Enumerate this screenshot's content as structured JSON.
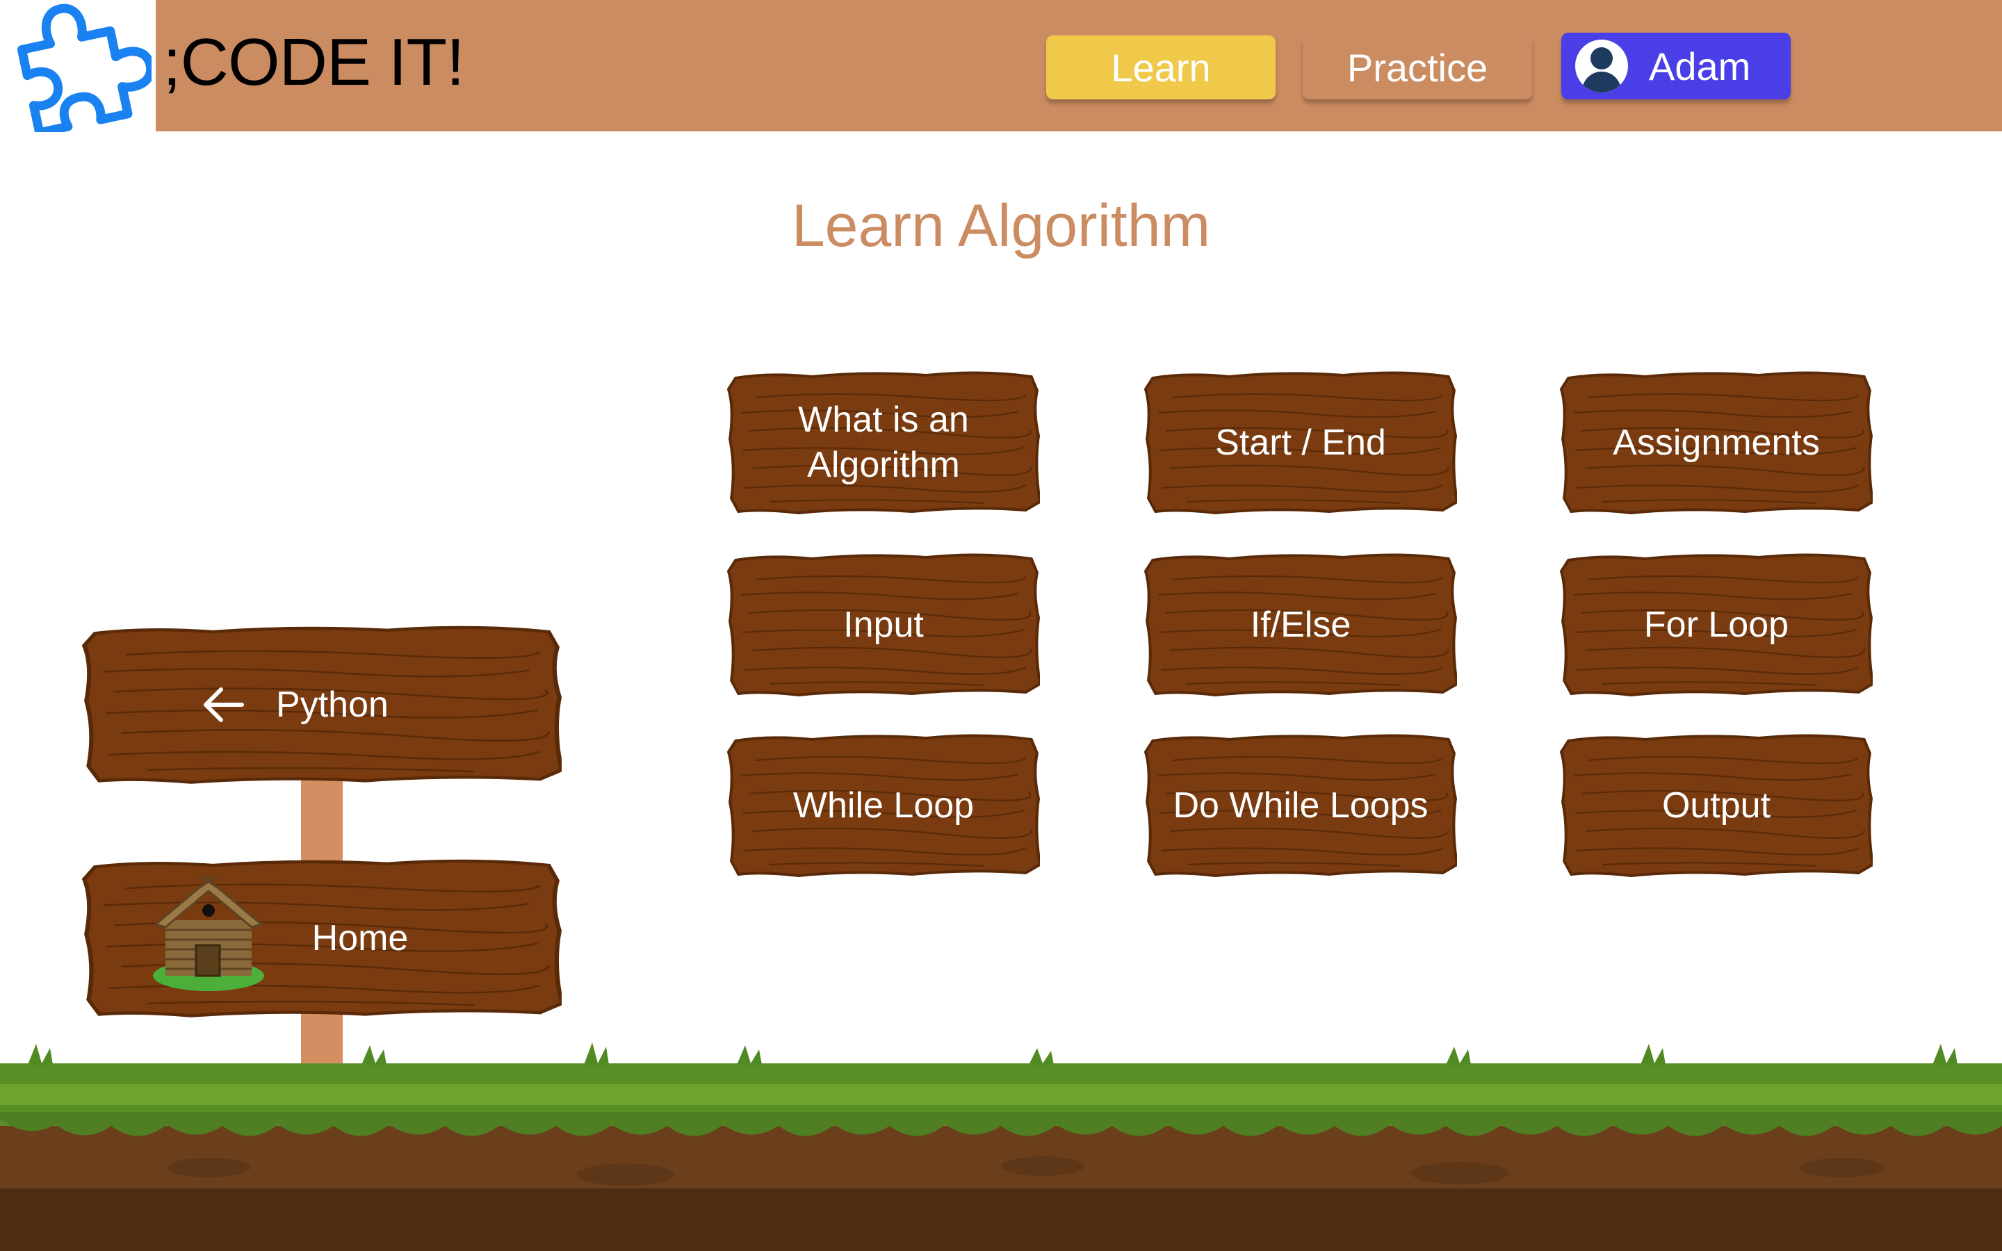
{
  "header": {
    "brand": ";CODE IT!",
    "nav": {
      "learn": "Learn",
      "practice": "Practice",
      "user": "Adam"
    }
  },
  "page": {
    "title": "Learn Algorithm"
  },
  "topics": [
    {
      "label": "What is an Algorithm"
    },
    {
      "label": "Start / End"
    },
    {
      "label": "Assignments"
    },
    {
      "label": "Input"
    },
    {
      "label": "If/Else"
    },
    {
      "label": "For Loop"
    },
    {
      "label": "While Loop"
    },
    {
      "label": "Do While Loops"
    },
    {
      "label": "Output"
    }
  ],
  "signpost": {
    "back": "Python",
    "home": "Home"
  },
  "colors": {
    "header": "#cc8c62",
    "learn_active": "#f0c94a",
    "user_button": "#4a3fe6",
    "wood": "#7a3b10",
    "logo": "#1a82f0",
    "grass": "#5a8f28"
  },
  "icons": [
    "puzzle-logo-icon",
    "user-avatar-icon",
    "back-arrow-icon",
    "cabin-icon"
  ]
}
